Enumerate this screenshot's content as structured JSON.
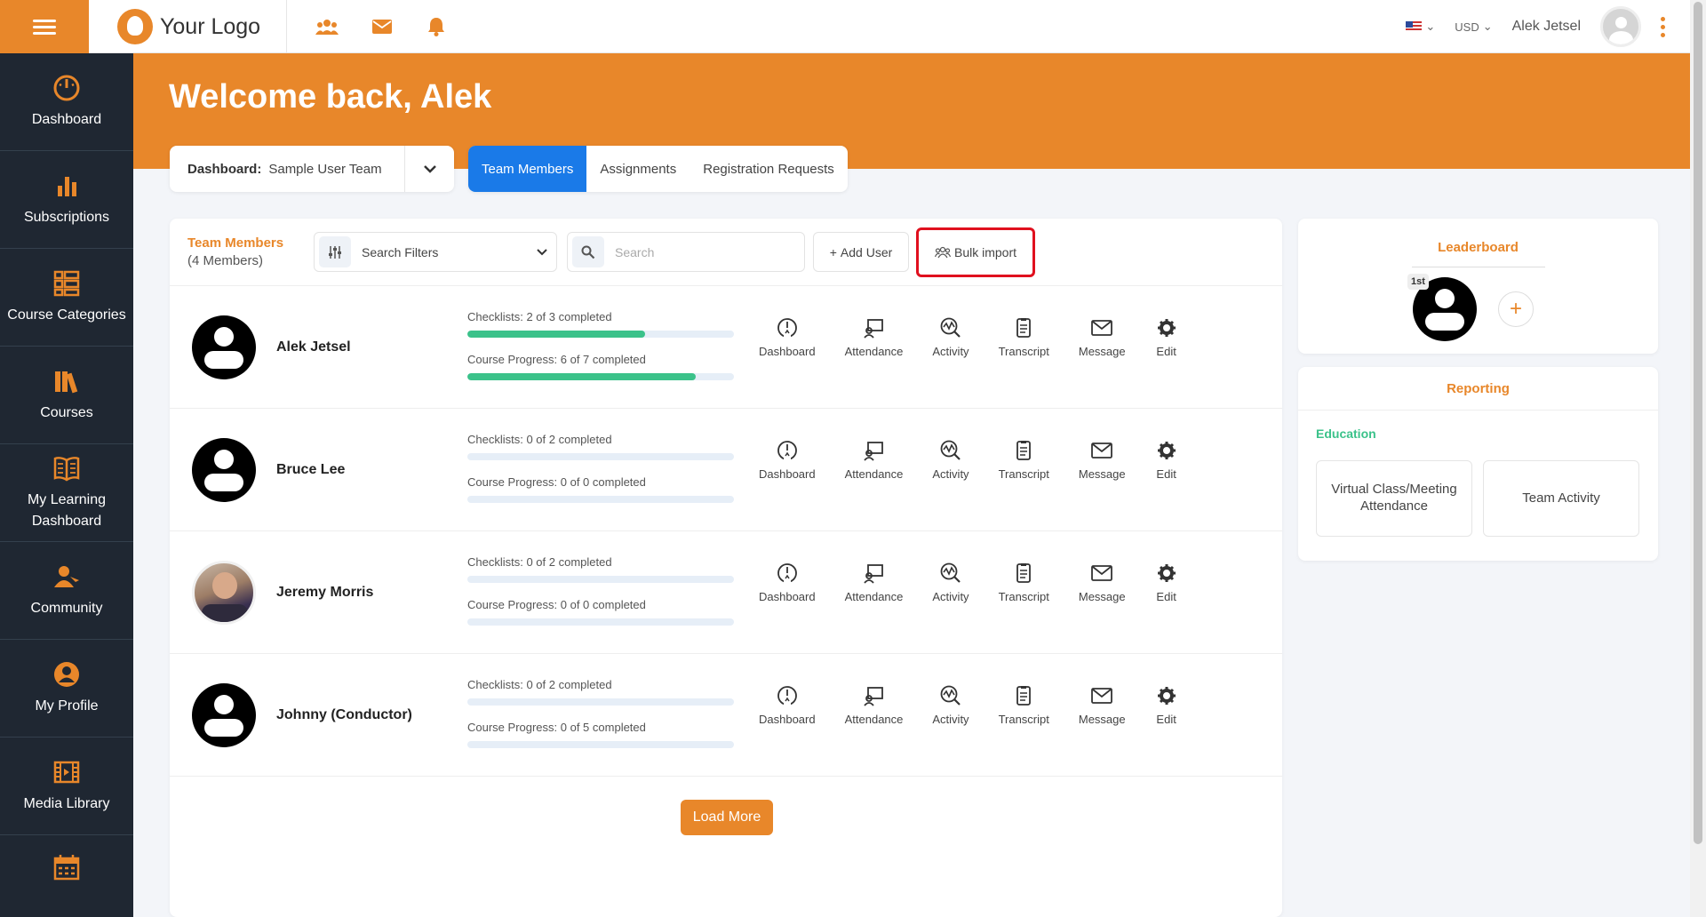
{
  "brand": {
    "logo_text": "Your Logo",
    "accent": "#e8872a",
    "link_blue": "#1a7ae8",
    "success": "#3bc28a"
  },
  "topbar": {
    "currency": "USD",
    "user_name": "Alek Jetsel"
  },
  "sidebar": {
    "items": [
      {
        "label": "Dashboard",
        "icon": "dashboard-icon"
      },
      {
        "label": "Subscriptions",
        "icon": "bar-chart-icon"
      },
      {
        "label": "Course Categories",
        "icon": "categories-icon"
      },
      {
        "label": "Courses",
        "icon": "books-icon"
      },
      {
        "label": "My Learning Dashboard",
        "icon": "open-book-icon"
      },
      {
        "label": "Community",
        "icon": "community-icon"
      },
      {
        "label": "My Profile",
        "icon": "profile-icon"
      },
      {
        "label": "Media Library",
        "icon": "film-icon"
      },
      {
        "label": "",
        "icon": "calendar-icon"
      }
    ]
  },
  "header": {
    "welcome": "Welcome back, Alek",
    "dashboard_label": "Dashboard:",
    "dashboard_value": "Sample User Team",
    "tabs": [
      "Team Members",
      "Assignments",
      "Registration Requests"
    ]
  },
  "team": {
    "title": "Team Members",
    "count": "(4 Members)",
    "filter_label": "Search Filters",
    "search_placeholder": "Search",
    "add_user": "Add User",
    "bulk_import": "Bulk import",
    "load_more": "Load More",
    "action_labels": [
      "Dashboard",
      "Attendance",
      "Activity",
      "Transcript",
      "Message",
      "Edit"
    ],
    "members": [
      {
        "name": "Alek Jetsel",
        "checklists": "Checklists: 2 of 3 completed",
        "checklist_fraction": 0.667,
        "course": "Course Progress: 6 of 7 completed",
        "course_fraction": 0.857
      },
      {
        "name": "Bruce Lee",
        "checklists": "Checklists: 0 of 2 completed",
        "checklist_fraction": 0,
        "course": "Course Progress: 0 of 0 completed",
        "course_fraction": 0
      },
      {
        "name": "Jeremy Morris",
        "checklists": "Checklists: 0 of 2 completed",
        "checklist_fraction": 0,
        "course": "Course Progress: 0 of 0 completed",
        "course_fraction": 0
      },
      {
        "name": "Johnny (Conductor)",
        "checklists": "Checklists: 0 of 2 completed",
        "checklist_fraction": 0,
        "course": "Course Progress: 0 of 5 completed",
        "course_fraction": 0
      }
    ]
  },
  "leaderboard": {
    "title": "Leaderboard",
    "rank": "1st"
  },
  "reporting": {
    "title": "Reporting",
    "section": "Education",
    "buttons": [
      "Virtual Class/Meeting Attendance",
      "Team Activity"
    ]
  }
}
